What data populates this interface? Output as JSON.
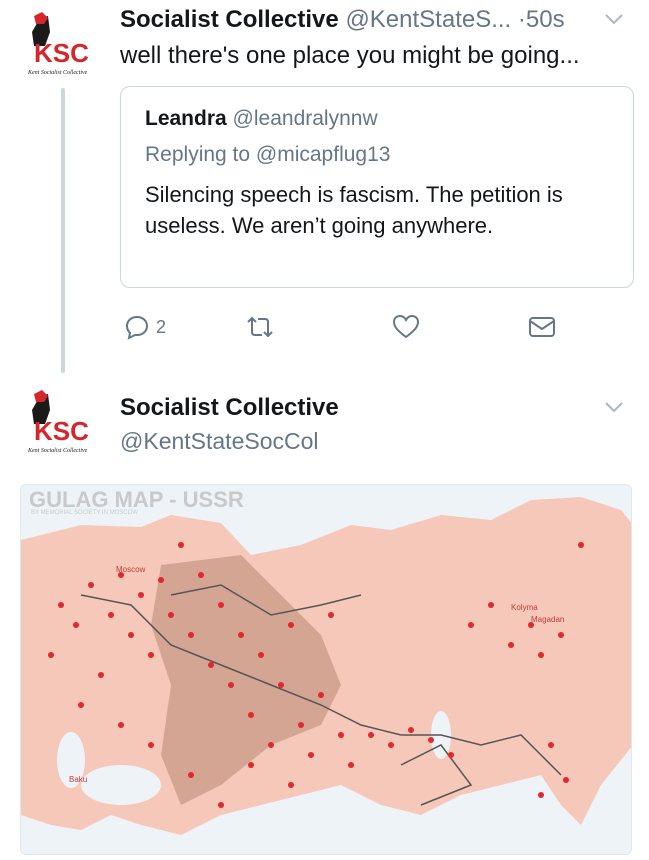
{
  "tweet1": {
    "name": "Socialist Collective",
    "handle": "@KentStateS...",
    "separator": "·",
    "time": "50s",
    "text": "well there's one place you might be going...",
    "avatar_text": "KSC",
    "avatar_caption": "Kent Socialist Collective"
  },
  "quote": {
    "name": "Leandra",
    "handle": "@leandralynnw",
    "replying": "Replying to @micapflug13",
    "body": "Silencing speech is fascism. The petition is useless. We aren’t going anywhere."
  },
  "actions": {
    "reply_count": "2"
  },
  "tweet2": {
    "name": "Socialist Collective",
    "handle": "@KentStateSocCol",
    "avatar_text": "KSC",
    "avatar_caption": "Kent Socialist Collective"
  },
  "map": {
    "title": "GULAG MAP - USSR",
    "subtitle": "BY MEMORIAL SOCIETY IN MOSCOW",
    "labels": {
      "moscow": "Moscow",
      "kolyma": "Kolyma",
      "magadan": "Magadan",
      "baku": "Baku"
    }
  },
  "colors": {
    "text": "#14171a",
    "secondary": "#657786",
    "border": "#ccd6dd",
    "avatar_red": "#d7262b",
    "map_land": "#f6c8b9",
    "map_camps": "#e0282e"
  }
}
